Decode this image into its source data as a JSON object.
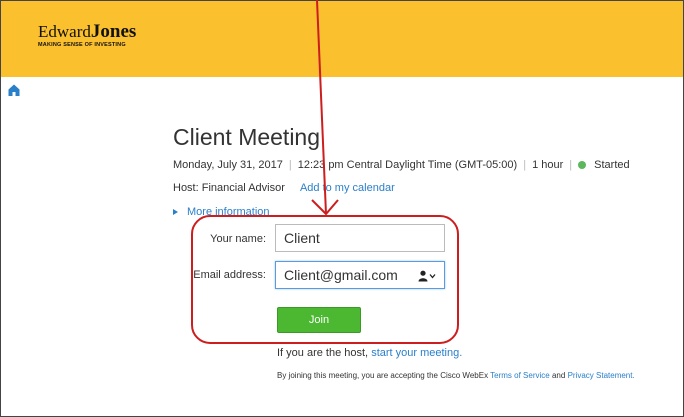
{
  "header": {
    "brand_word1": "Edward",
    "brand_word2": "Jones",
    "tagline": "MAKING SENSE OF INVESTING",
    "background_color": "#fbc02d"
  },
  "nav": {
    "home_icon": "home-icon"
  },
  "meeting": {
    "title": "Client Meeting",
    "date": "Monday, July 31, 2017",
    "time": "12:23 pm Central Daylight Time (GMT-05:00)",
    "duration": "1 hour",
    "status": "Started",
    "status_color": "#5cb85c",
    "host": "Host: Financial Advisor",
    "add_calendar": "Add to my calendar",
    "more_info": "More information"
  },
  "form": {
    "name_label": "Your name:",
    "name_value": "Client",
    "email_label": "Email address:",
    "email_value": "Client@gmail.com",
    "user_icon": "user-dropdown-icon",
    "join_label": "Join",
    "join_color": "#4cb832"
  },
  "footer": {
    "host_prefix": "If you are the host,",
    "host_link": "start your meeting.",
    "terms_prefix": "By joining this meeting, you are accepting the Cisco WebEx",
    "terms_link": "Terms of Service",
    "terms_and": "and",
    "privacy_link": "Privacy Statement."
  },
  "annotation_color": "#cc1e1e"
}
